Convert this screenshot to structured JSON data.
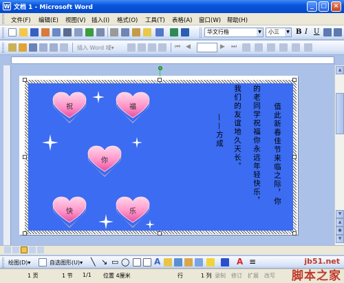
{
  "window": {
    "title": "文档 1 - Microsoft Word",
    "min": "_",
    "max": "□",
    "close": "×"
  },
  "menu": [
    "文件(F)",
    "编辑(E)",
    "视图(V)",
    "插入(I)",
    "格式(O)",
    "工具(T)",
    "表格(A)",
    "窗口(W)",
    "帮助(H)"
  ],
  "toolbar": {
    "font": "华文行楷",
    "size": "小三",
    "bold": "B",
    "italic": "I",
    "underline": "U",
    "insert_word_label": "插入 Word 域▾"
  },
  "card": {
    "hearts": [
      "祝",
      "福",
      "你",
      "快",
      "乐"
    ],
    "columns": [
      "值此新春佳节来临之际，你",
      "的老同学祝福你永远年轻快乐，",
      "我们的友谊地久天长。",
      "——方成"
    ]
  },
  "drawbar": {
    "draw": "绘图(D)▾",
    "autoshape": "自选图形(U)▾"
  },
  "status": {
    "page": "1 页",
    "section": "1 节",
    "pages": "1/1",
    "pos": "位置 4厘米",
    "line": "行",
    "col": "1 列",
    "rec": "录制",
    "trk": "修订",
    "ext": "扩展",
    "ovr": "改写"
  },
  "watermark": {
    "site": "jb51.net",
    "name": "脚本之家"
  },
  "colors": {
    "canvas": "#3b6cf1",
    "heart_top": "#ff9ccc",
    "heart_side": "#b0a2c2",
    "titlebar": "#0a55de",
    "watermark": "#c0392b"
  }
}
